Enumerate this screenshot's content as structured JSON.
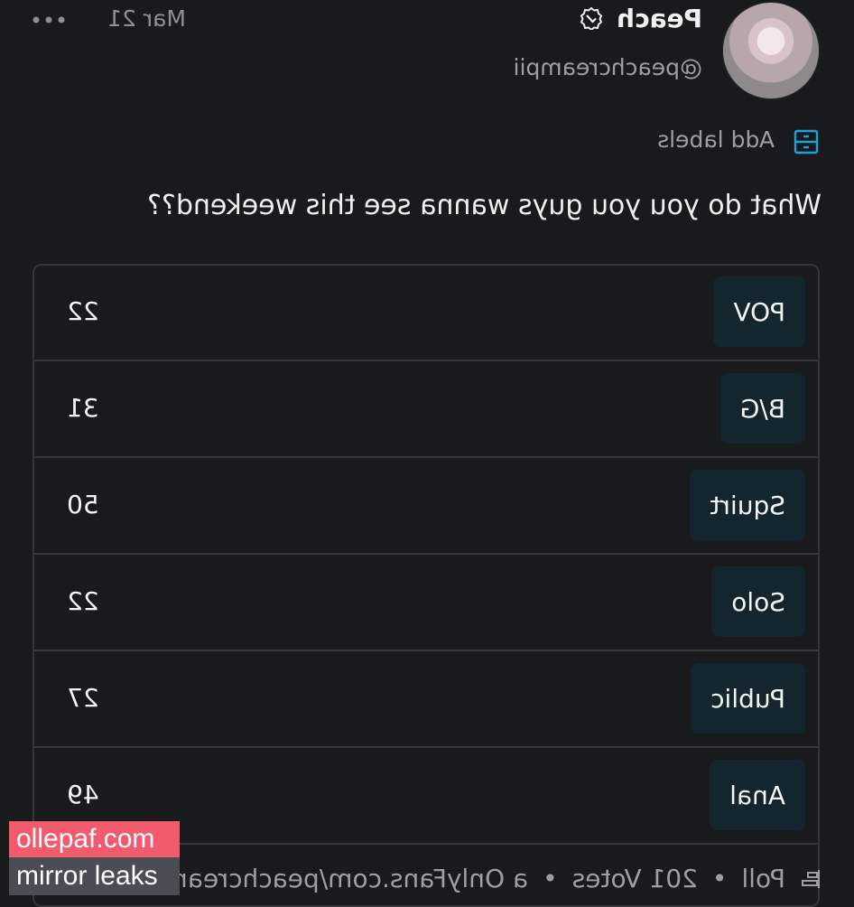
{
  "post": {
    "author_name": "Peach",
    "author_handle": "@peachcreampii",
    "date": "Mar 21",
    "add_labels": "Add labels",
    "question": "What do you you guys wanna see this weekend??"
  },
  "poll": {
    "options": [
      {
        "label": "POV",
        "votes": "22"
      },
      {
        "label": "B/G",
        "votes": "31"
      },
      {
        "label": "Squirt",
        "votes": "50"
      },
      {
        "label": "Solo",
        "votes": "22"
      },
      {
        "label": "Public",
        "votes": "27"
      },
      {
        "label": "Anal",
        "votes": "49"
      }
    ],
    "footer_poll": "Poll",
    "footer_votes": "201 Votes",
    "footer_source": "a OnlyFans.com/peachcreampii"
  },
  "watermark": {
    "line1": "ollepaf.com",
    "line2": "mirror leaks"
  },
  "colors": {
    "background": "#191a1c",
    "pill": "#13262d",
    "accent_icon": "#1da1d9",
    "watermark_pink": "#f25a6d",
    "watermark_gray": "#4a4d56"
  }
}
